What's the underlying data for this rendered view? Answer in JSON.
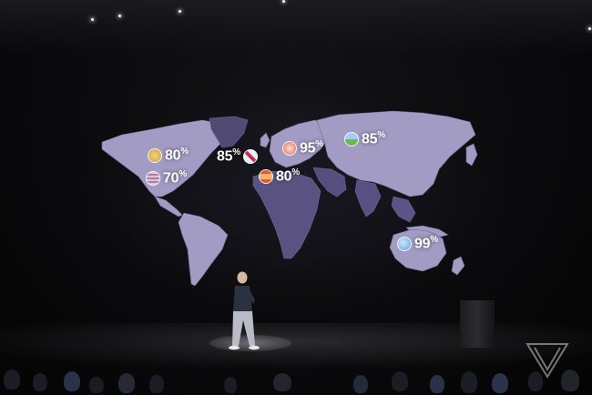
{
  "stats": [
    {
      "id": "north-america-top",
      "value": "80",
      "unit": "%",
      "flag_colors": [
        "#f2d27a",
        "#c9a14a"
      ]
    },
    {
      "id": "north-america-bottom",
      "value": "70",
      "unit": "%",
      "flag_colors": [
        "#d9c7d8",
        "#b07fa0"
      ]
    },
    {
      "id": "atlantic",
      "value": "85",
      "unit": "%",
      "flag_colors": [
        "#e8eef8",
        "#c4324a"
      ]
    },
    {
      "id": "europe-central",
      "value": "95",
      "unit": "%",
      "flag_colors": [
        "#f6e0d6",
        "#e06d55"
      ]
    },
    {
      "id": "europe-south",
      "value": "80",
      "unit": "%",
      "flag_colors": [
        "#f2b36a",
        "#e05a38"
      ]
    },
    {
      "id": "russia",
      "value": "85",
      "unit": "%",
      "flag_colors": [
        "#9fd0ef",
        "#6db65c"
      ]
    },
    {
      "id": "australia",
      "value": "99",
      "unit": "%",
      "flag_colors": [
        "#5aa4e0",
        "#cfe6f8"
      ]
    }
  ],
  "colors": {
    "land": "#a29cc4",
    "land_shadow": "#4a4368",
    "background": "#0a0a0c"
  },
  "watermark_icon": "triangle-logo-icon"
}
